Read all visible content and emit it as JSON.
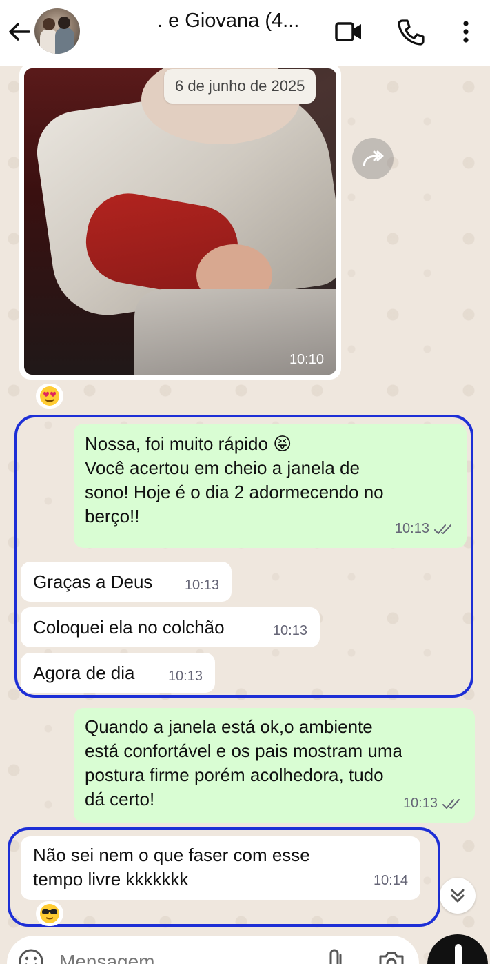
{
  "header": {
    "title": ". e Giovana (4...",
    "back_icon": "arrow-left-icon",
    "video_icon": "video-camera-icon",
    "call_icon": "phone-icon",
    "menu_icon": "more-vertical-icon"
  },
  "chat": {
    "date_separator": "6 de junho de 2025",
    "photo_message": {
      "time": "10:10",
      "reaction": "heart-eyes-emoji"
    },
    "messages": [
      {
        "direction": "outgoing",
        "lines": [
          "Nossa, foi muito rápido 😝",
          "Você acertou em cheio a janela de",
          "sono! Hoje é o dia 2 adormecendo no",
          "berço!!"
        ],
        "time": "10:13",
        "status": "read"
      },
      {
        "direction": "incoming",
        "text": "Graças a Deus",
        "time": "10:13"
      },
      {
        "direction": "incoming",
        "text": "Coloquei ela no colchão",
        "time": "10:13"
      },
      {
        "direction": "incoming",
        "text": "Agora de dia",
        "time": "10:13"
      },
      {
        "direction": "outgoing",
        "lines": [
          "Quando a janela está ok,o ambiente",
          "está confortável e os pais mostram uma",
          "postura firme porém acolhedora, tudo",
          "dá certo!"
        ],
        "time": "10:13",
        "status": "read"
      },
      {
        "direction": "incoming",
        "lines": [
          "Não sei nem o que faser com esse",
          "tempo livre kkkkkkk"
        ],
        "time": "10:14",
        "reaction": "sunglasses-emoji"
      }
    ]
  },
  "input": {
    "placeholder": "Mensagem",
    "emoji_icon": "emoji-icon",
    "attach_icon": "paperclip-icon",
    "camera_icon": "camera-icon",
    "mic_icon": "microphone-icon"
  },
  "colors": {
    "outgoing_bubble": "#d9fdd3",
    "incoming_bubble": "#ffffff",
    "highlight_border": "#1d2fd6",
    "chat_background": "#efe7de"
  }
}
